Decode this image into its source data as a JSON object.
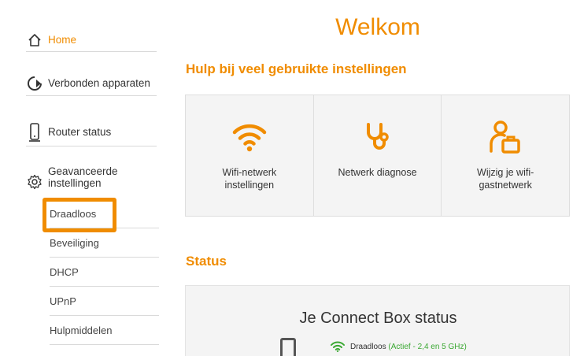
{
  "sidebar": {
    "home": "Home",
    "devices": "Verbonden apparaten",
    "router_status": "Router status",
    "advanced_line1": "Geavanceerde",
    "advanced_line2": "instellingen",
    "sub_items": [
      "Draadloos",
      "Beveiliging",
      "DHCP",
      "UPnP",
      "Hulpmiddelen"
    ]
  },
  "main": {
    "title": "Welkom",
    "help_title": "Hulp bij veel gebruikte instellingen",
    "cards": [
      {
        "label": "Wifi-netwerk\ninstellingen",
        "icon": "wifi-icon"
      },
      {
        "label": "Netwerk diagnose",
        "icon": "stethoscope-icon"
      },
      {
        "label": "Wijzig je wifi-\ngastnetwerk",
        "icon": "guest-user-icon"
      }
    ],
    "status_title": "Status",
    "status_heading": "Je Connect Box status",
    "wifi_label": "Draadloos",
    "wifi_status": "(Actief - 2,4 en 5 GHz)"
  },
  "colors": {
    "accent": "#f08c00",
    "status_green": "#3aa832"
  }
}
